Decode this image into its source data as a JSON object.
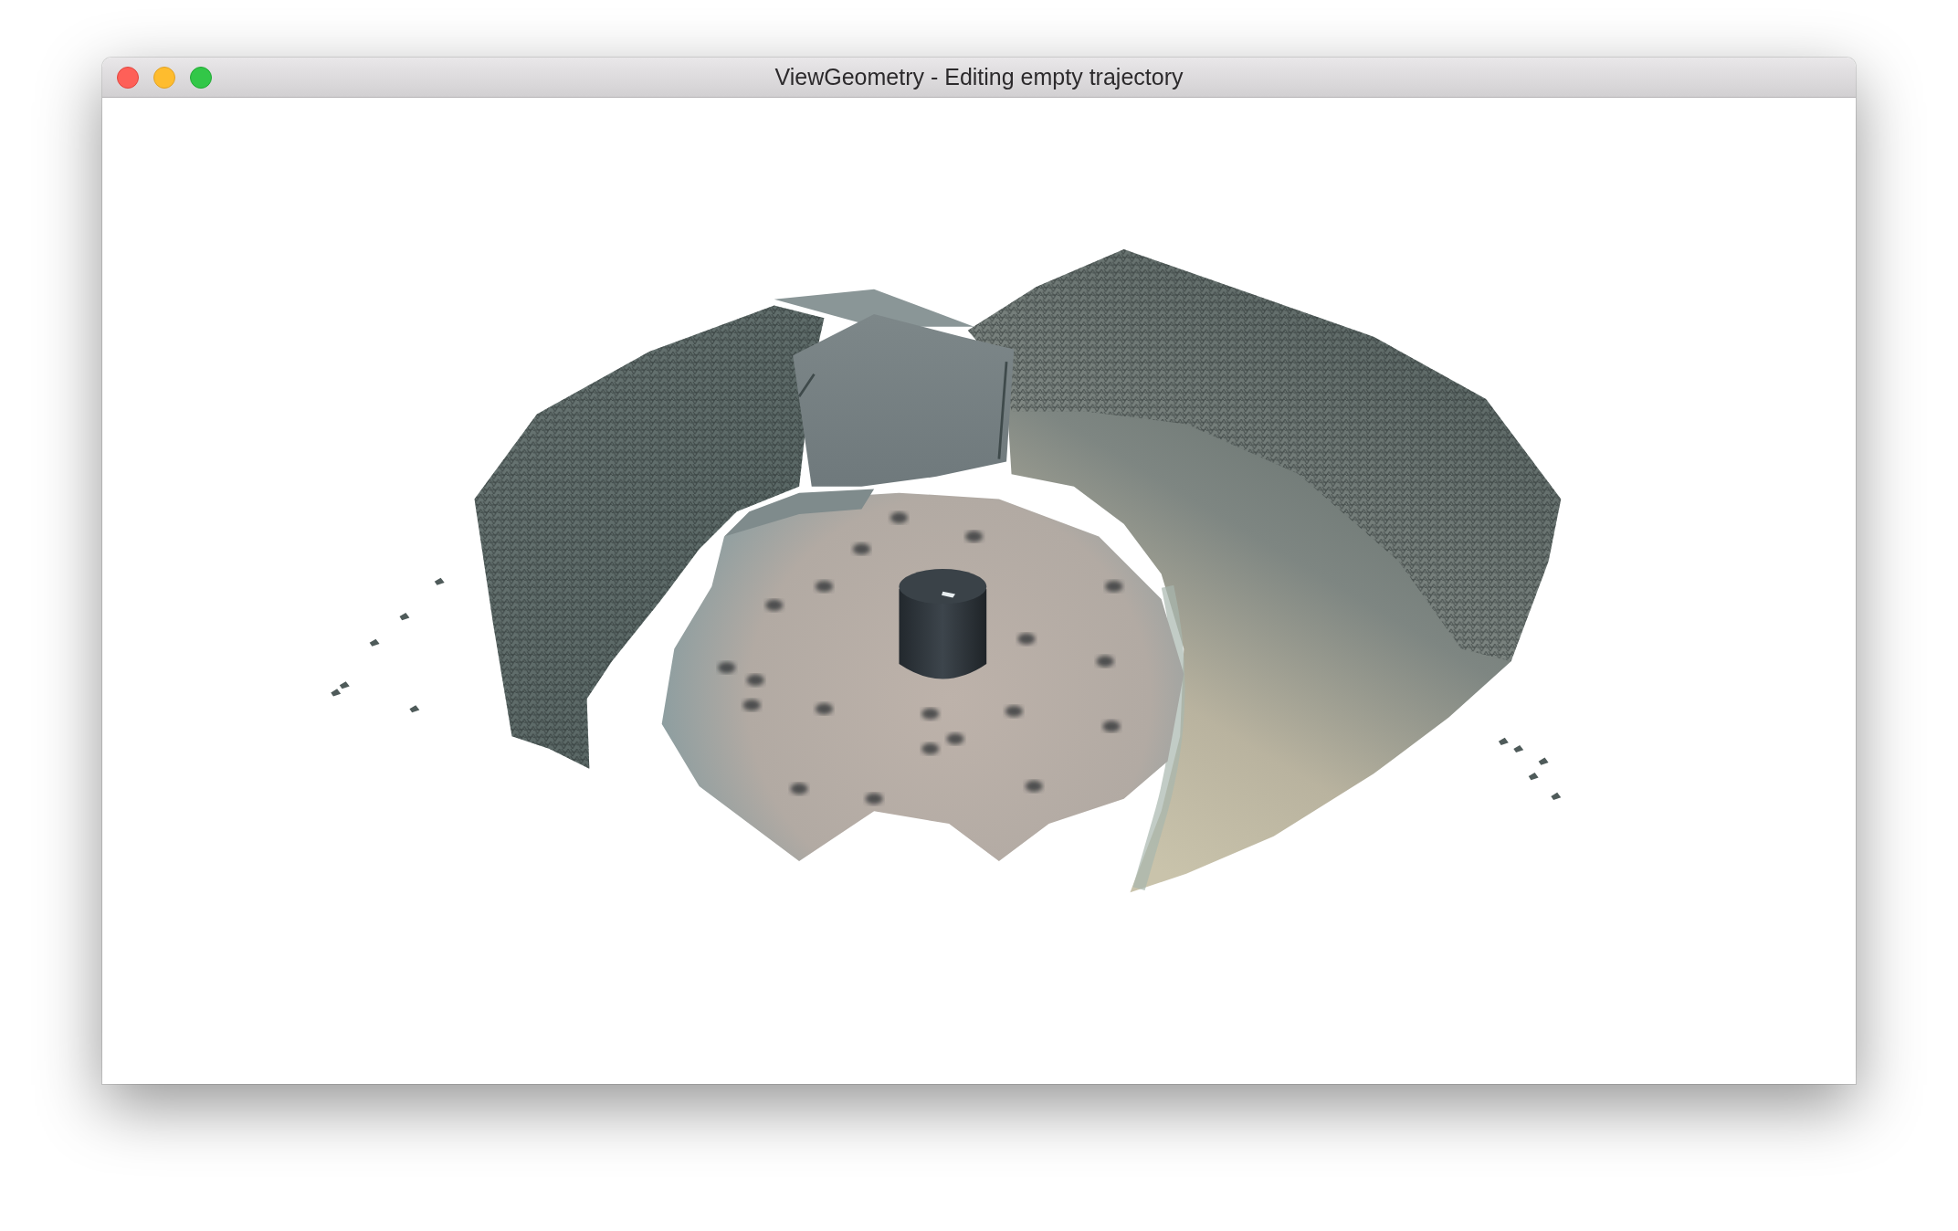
{
  "window": {
    "title": "ViewGeometry - Editing empty trajectory"
  }
}
